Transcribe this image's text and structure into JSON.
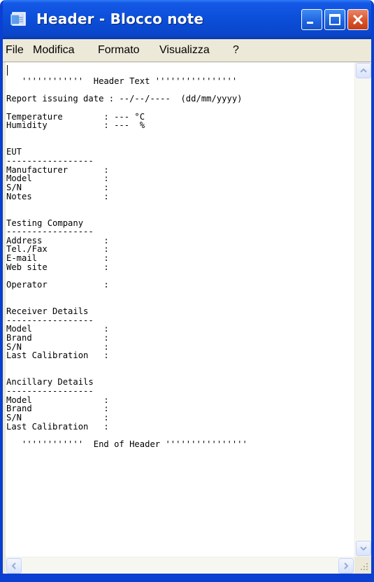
{
  "window": {
    "title": "Header - Blocco note",
    "colors": {
      "titlebar": "#0b4ed8",
      "close_button": "#d9532d",
      "frame": "#0a3fd1"
    }
  },
  "menu": [
    "File",
    "Modifica",
    "Formato",
    "Visualizza",
    "?"
  ],
  "document": {
    "text": "   ''''''''''''  Header Text ''''''''''''''''\n\nReport issuing date : --/--/----  (dd/mm/yyyy)\n\nTemperature        : --- °C\nHumidity           : ---  %\n\n\nEUT\n-----------------\nManufacturer       :\nModel              :\nS/N                :\nNotes              :\n\n\nTesting Company\n-----------------\nAddress            :\nTel./Fax           :\nE-mail             :\nWeb site           :\n\nOperator           :\n\n\nReceiver Details\n-----------------\nModel              :\nBrand              :\nS/N                :\nLast Calibration   :\n\n\nAncillary Details\n-----------------\nModel              :\nBrand              :\nS/N                :\nLast Calibration   :\n\n   ''''''''''''  End of Header ''''''''''''''''"
  },
  "icons": {
    "app": "notepad-icon",
    "minimize": "minimize-icon",
    "maximize": "maximize-icon",
    "close": "close-icon",
    "scroll_up": "chevron-up-icon",
    "scroll_down": "chevron-down-icon",
    "scroll_left": "chevron-left-icon",
    "scroll_right": "chevron-right-icon",
    "resize": "resize-grip-icon"
  }
}
